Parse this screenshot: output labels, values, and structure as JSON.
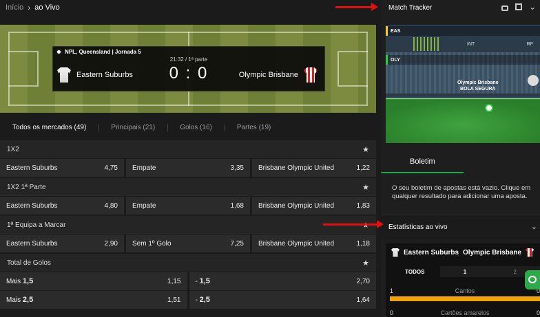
{
  "breadcrumb": {
    "home": "Início",
    "separator": "›",
    "current": "ao Vivo"
  },
  "match": {
    "competition": "NPL, Queensland | Jornada 5",
    "time": "21:32 / 1ª parte",
    "score": "0 : 0",
    "home_team": "Eastern Suburbs",
    "away_team": "Olympic Brisbane"
  },
  "market_tabs": [
    {
      "label": "Todos os mercados (49)",
      "active": true
    },
    {
      "label": "Principais (21)"
    },
    {
      "label": "Golos (16)"
    },
    {
      "label": "Partes (19)"
    }
  ],
  "markets": [
    {
      "title": "1X2",
      "rows": [
        [
          {
            "label": "Eastern Suburbs",
            "price": "4,75"
          },
          {
            "label": "Empate",
            "price": "3,35"
          },
          {
            "label": "Brisbane Olympic United",
            "price": "1,22"
          }
        ]
      ]
    },
    {
      "title": "1X2 1ª Parte",
      "rows": [
        [
          {
            "label": "Eastern Suburbs",
            "price": "4,80"
          },
          {
            "label": "Empate",
            "price": "1,68"
          },
          {
            "label": "Brisbane Olympic United",
            "price": "1,83"
          }
        ]
      ]
    },
    {
      "title": "1ª Equipa a Marcar",
      "rows": [
        [
          {
            "label": "Eastern Suburbs",
            "price": "2,90"
          },
          {
            "label": "Sem 1º Golo",
            "price": "7,25"
          },
          {
            "label": "Brisbane Olympic United",
            "price": "1,18"
          }
        ]
      ]
    },
    {
      "title": "Total de Golos",
      "rows": [
        [
          {
            "prefix": "Mais",
            "line": "1,5",
            "price": "1,15"
          },
          {
            "prefix": "-",
            "line": "1,5",
            "price": "2,70"
          }
        ],
        [
          {
            "prefix": "Mais",
            "line": "2,5",
            "price": "1,51"
          },
          {
            "prefix": "-",
            "line": "2,5",
            "price": "1,64"
          }
        ]
      ]
    }
  ],
  "tracker": {
    "title": "Match Tracker",
    "home_abbr": "EAS",
    "away_abbr": "OLY",
    "label_int": "INT",
    "label_rf": "RF",
    "status_team": "Olympic Brisbane",
    "status_text": "BOLA SEGURA",
    "icons": [
      "lock-icon",
      "expand-icon",
      "chevron-down-icon"
    ]
  },
  "betslip": {
    "tab": "Boletim",
    "empty_message": "O seu boletim de apostas está vazio. Clique em qualquer resultado para adicionar uma aposta."
  },
  "stats": {
    "title": "Estatísticas ao vivo",
    "home": "Eastern Suburbs",
    "away": "Olympic Brisbane",
    "tabs": [
      "TODOS",
      "1",
      "2"
    ],
    "rows": [
      {
        "label": "Cantos",
        "home": "1",
        "away": "0"
      },
      {
        "label": "Cartões amarelos",
        "home": "0",
        "away": "0"
      }
    ]
  },
  "colors": {
    "accent_green": "#25a849",
    "stat_bar": "#f0a500",
    "arrow": "#e01010"
  }
}
